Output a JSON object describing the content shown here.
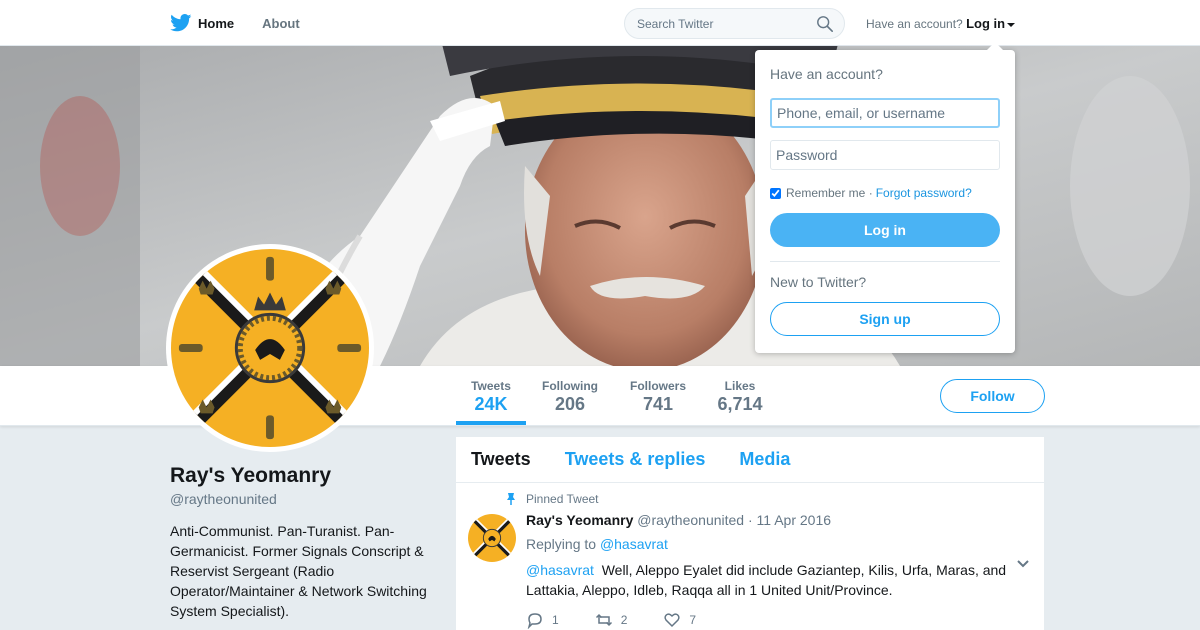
{
  "nav": {
    "home_label": "Home",
    "about_label": "About",
    "search_placeholder": "Search Twitter",
    "have_account": "Have an account?",
    "login_label": "Log in"
  },
  "profile": {
    "name": "Ray's Yeomanry",
    "handle": "@raytheonunited",
    "bio": "Anti-Communist. Pan-Turanist. Pan-Germanicist. Former Signals Conscript & Reservist Sergeant (Radio Operator/Maintainer & Network Switching System Specialist).",
    "follow_label": "Follow",
    "stats": [
      {
        "label": "Tweets",
        "value": "24K"
      },
      {
        "label": "Following",
        "value": "206"
      },
      {
        "label": "Followers",
        "value": "741"
      },
      {
        "label": "Likes",
        "value": "6,714"
      }
    ]
  },
  "timeline": {
    "tabs": [
      "Tweets",
      "Tweets & replies",
      "Media"
    ],
    "tweet": {
      "pinned_label": "Pinned Tweet",
      "name": "Ray's Yeomanry",
      "handle": "@raytheonunited",
      "separator": "·",
      "date": "11 Apr 2016",
      "replying_prefix": "Replying to",
      "replying_to": "@hasavrat",
      "mention": "@hasavrat",
      "text": "Well, Aleppo Eyalet did include Gaziantep, Kilis, Urfa, Maras, and Lattakia, Aleppo, Idleb, Raqqa all in 1 United Unit/Province.",
      "replies": "1",
      "retweets": "2",
      "likes": "7"
    }
  },
  "login_dropdown": {
    "title": "Have an account?",
    "username_placeholder": "Phone, email, or username",
    "password_placeholder": "Password",
    "remember_label": "Remember me",
    "separator": "·",
    "forgot_label": "Forgot password?",
    "login_button": "Log in",
    "new_to": "New to Twitter?",
    "signup_button": "Sign up"
  },
  "colors": {
    "accent": "#1da1f2",
    "login_button": "#4ab3f4",
    "avatar_flag": "#f5b024"
  }
}
